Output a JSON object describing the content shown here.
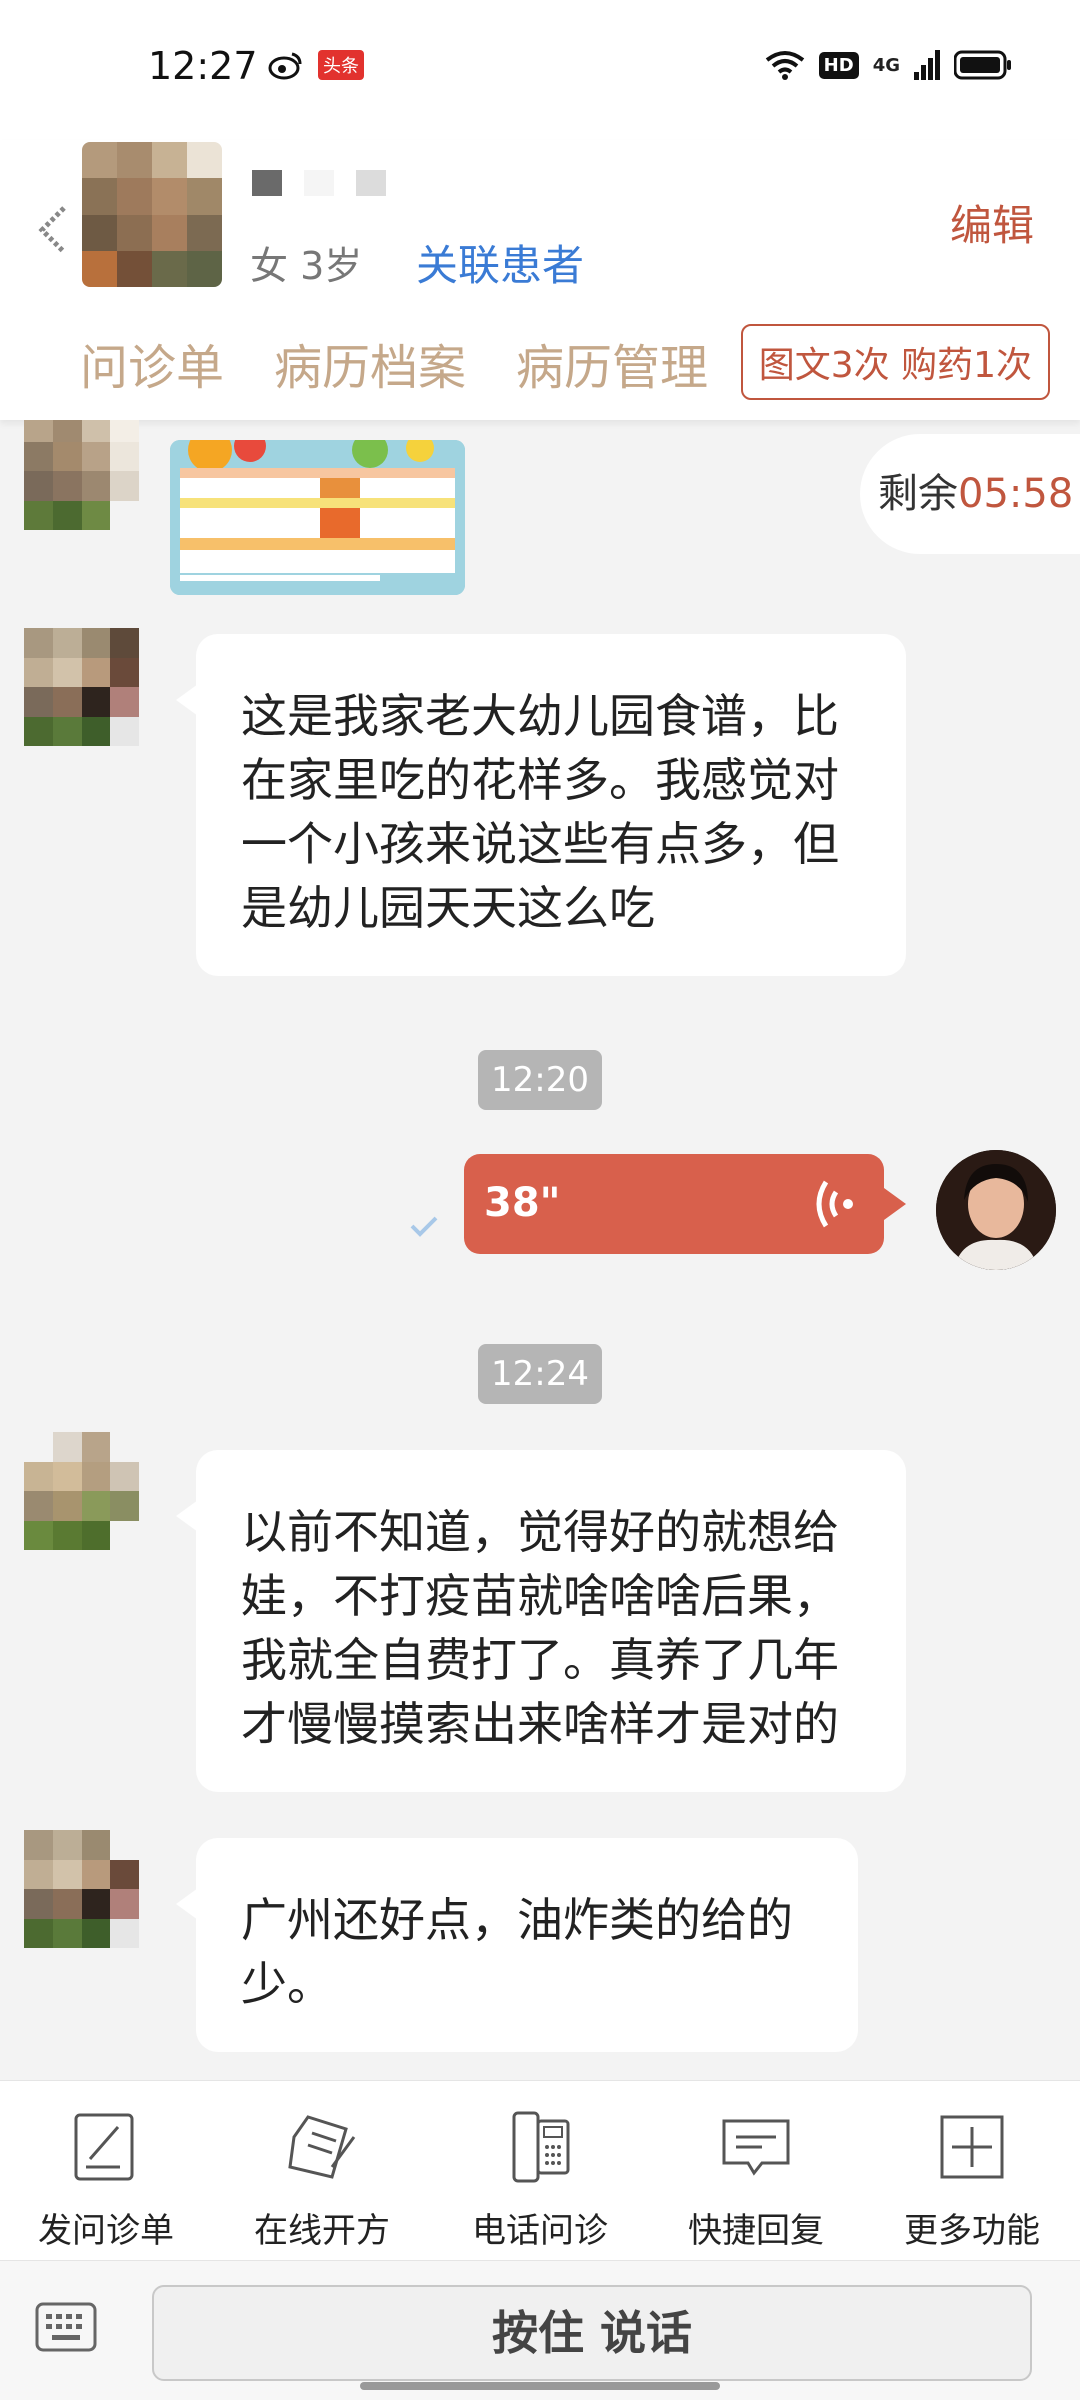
{
  "status_bar": {
    "time": "12:27",
    "toutiao_badge": "头条",
    "hd_badge": "HD",
    "network": "4G"
  },
  "header": {
    "patient_info": "女 3岁",
    "link_patient": "关联患者",
    "edit": "编辑",
    "tabs": [
      "问诊单",
      "病历档案",
      "病历管理"
    ],
    "quota": "图文3次 购药1次"
  },
  "chat": {
    "remaining_label": "剩余",
    "remaining_count": "05:58",
    "messages": [
      {
        "text": "这是我家老大幼儿园食谱，比在家里吃的花样多。我感觉对一个小孩来说这些有点多，但是幼儿园天天这么吃"
      },
      {
        "text": "以前不知道，觉得好的就想给娃，不打疫苗就啥啥啥后果，我就全自费打了。真养了几年才慢慢摸索出来啥样才是对的"
      },
      {
        "text": "广州还好点，油炸类的给的少。"
      }
    ],
    "timestamps": [
      "12:20",
      "12:24"
    ],
    "voice_duration": "38\""
  },
  "toolbar": {
    "items": [
      "发问诊单",
      "在线开方",
      "电话问诊",
      "快捷回复",
      "更多功能"
    ]
  },
  "input": {
    "talk_button": "按住 说话"
  },
  "colors": {
    "accent": "#c0563e",
    "voice_bubble": "#d8604c",
    "link": "#3a7bd5",
    "tab": "#c5a88a"
  }
}
